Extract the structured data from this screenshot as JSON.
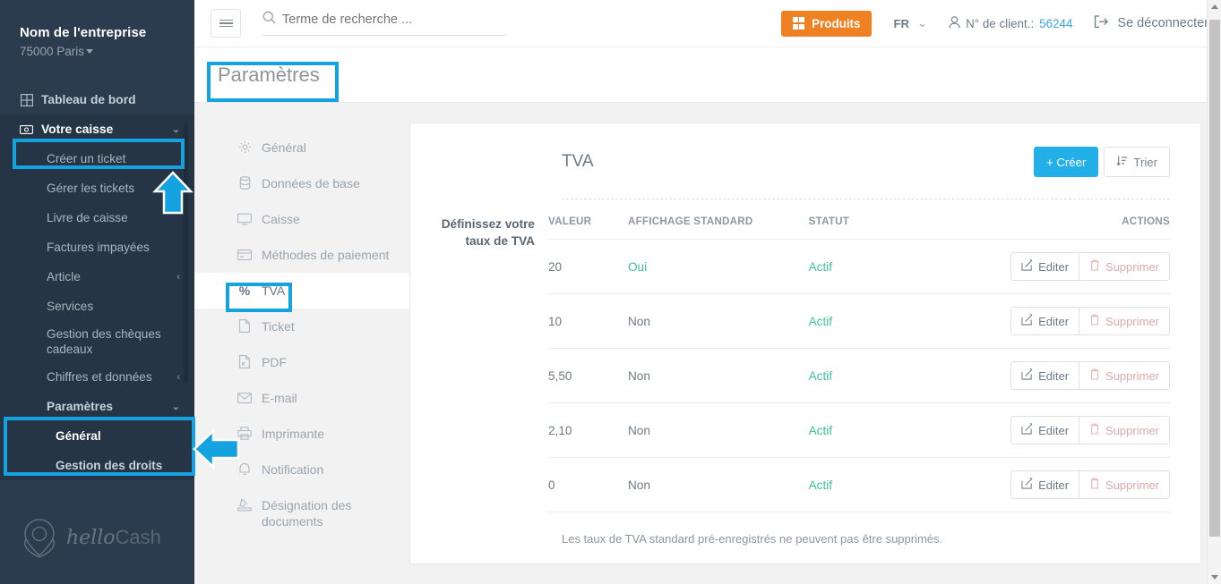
{
  "colors": {
    "sidebar_bg": "#2b3c4e",
    "accent_blue": "#23b0e8",
    "annotation_blue": "#14a3e0",
    "orange": "#f08122",
    "green": "#3fbf9a"
  },
  "sidebar": {
    "company_name": "Nom de l'entreprise",
    "company_location": "75000 Paris",
    "items": [
      {
        "label": "Tableau de bord",
        "icon": "dashboard-grid-icon",
        "type": "root"
      },
      {
        "label": "Votre caisse",
        "icon": "cash-register-icon",
        "type": "root",
        "expanded": true,
        "chevron": "chevron-down-icon"
      }
    ],
    "caisse_children": [
      {
        "label": "Créer un ticket"
      },
      {
        "label": "Gérer les tickets"
      },
      {
        "label": "Livre de caisse"
      },
      {
        "label": "Factures impayées"
      },
      {
        "label": "Article",
        "chevron": "chevron-left-icon"
      },
      {
        "label": "Services"
      },
      {
        "label": "Gestion des chèques cadeaux"
      },
      {
        "label": "Chiffres et données",
        "chevron": "chevron-left-icon"
      },
      {
        "label": "Paramètres",
        "chevron": "chevron-down-icon",
        "bold": true
      },
      {
        "label": "Général",
        "active": true
      },
      {
        "label": "Gestion des droits",
        "bold": true
      }
    ],
    "logo_text_italic": "hello",
    "logo_text_plain": "Cash"
  },
  "topbar": {
    "menu_icon": "hamburger-icon",
    "search": {
      "icon": "search-icon",
      "placeholder": "Terme de recherche ...",
      "value": ""
    },
    "products_button": {
      "label": "Produits",
      "icon": "grid-icon"
    },
    "language": {
      "label": "FR",
      "chevron": "chevron-down-icon"
    },
    "client": {
      "icon": "user-icon",
      "label": "N° de client.:",
      "number": "56244"
    },
    "logout": {
      "icon": "logout-icon",
      "label": "Se déconnecter"
    }
  },
  "page": {
    "title": "Paramètres"
  },
  "settings_tabs": [
    {
      "label": "Général",
      "icon": "gear-icon",
      "active": false
    },
    {
      "label": "Données de base",
      "icon": "database-icon",
      "active": false
    },
    {
      "label": "Caisse",
      "icon": "monitor-icon",
      "active": false
    },
    {
      "label": "Méthodes de paiement",
      "icon": "credit-card-icon",
      "active": false
    },
    {
      "label": "TVA",
      "icon": "percent-icon",
      "active": true
    },
    {
      "label": "Ticket",
      "icon": "receipt-icon",
      "active": false
    },
    {
      "label": "PDF",
      "icon": "pdf-file-icon",
      "active": false
    },
    {
      "label": "E-mail",
      "icon": "envelope-icon",
      "active": false
    },
    {
      "label": "Imprimante",
      "icon": "printer-icon",
      "active": false
    },
    {
      "label": "Notification",
      "icon": "bell-icon",
      "active": false
    },
    {
      "label": "Désignation des documents",
      "icon": "document-signature-icon",
      "active": false
    }
  ],
  "tva_panel": {
    "title": "TVA",
    "create_button": {
      "label": "Créer",
      "icon": "plus-icon"
    },
    "sort_button": {
      "label": "Trier",
      "icon": "sort-icon"
    },
    "section_label": "Définissez votre taux de TVA",
    "columns": [
      "VALEUR",
      "AFFICHAGE STANDARD",
      "STATUT",
      "ACTIONS"
    ],
    "rows": [
      {
        "valeur": "20",
        "affichage": "Oui",
        "statut": "Actif",
        "affichage_highlight": true
      },
      {
        "valeur": "10",
        "affichage": "Non",
        "statut": "Actif",
        "affichage_highlight": false
      },
      {
        "valeur": "5,50",
        "affichage": "Non",
        "statut": "Actif",
        "affichage_highlight": false
      },
      {
        "valeur": "2,10",
        "affichage": "Non",
        "statut": "Actif",
        "affichage_highlight": false
      },
      {
        "valeur": "0",
        "affichage": "Non",
        "statut": "Actif",
        "affichage_highlight": false
      }
    ],
    "edit_label": "Editer",
    "edit_icon": "pencil-square-icon",
    "delete_label": "Supprimer",
    "delete_icon": "trash-icon",
    "footnote": "Les taux de TVA standard pré-enregistrés ne peuvent pas être supprimés."
  }
}
